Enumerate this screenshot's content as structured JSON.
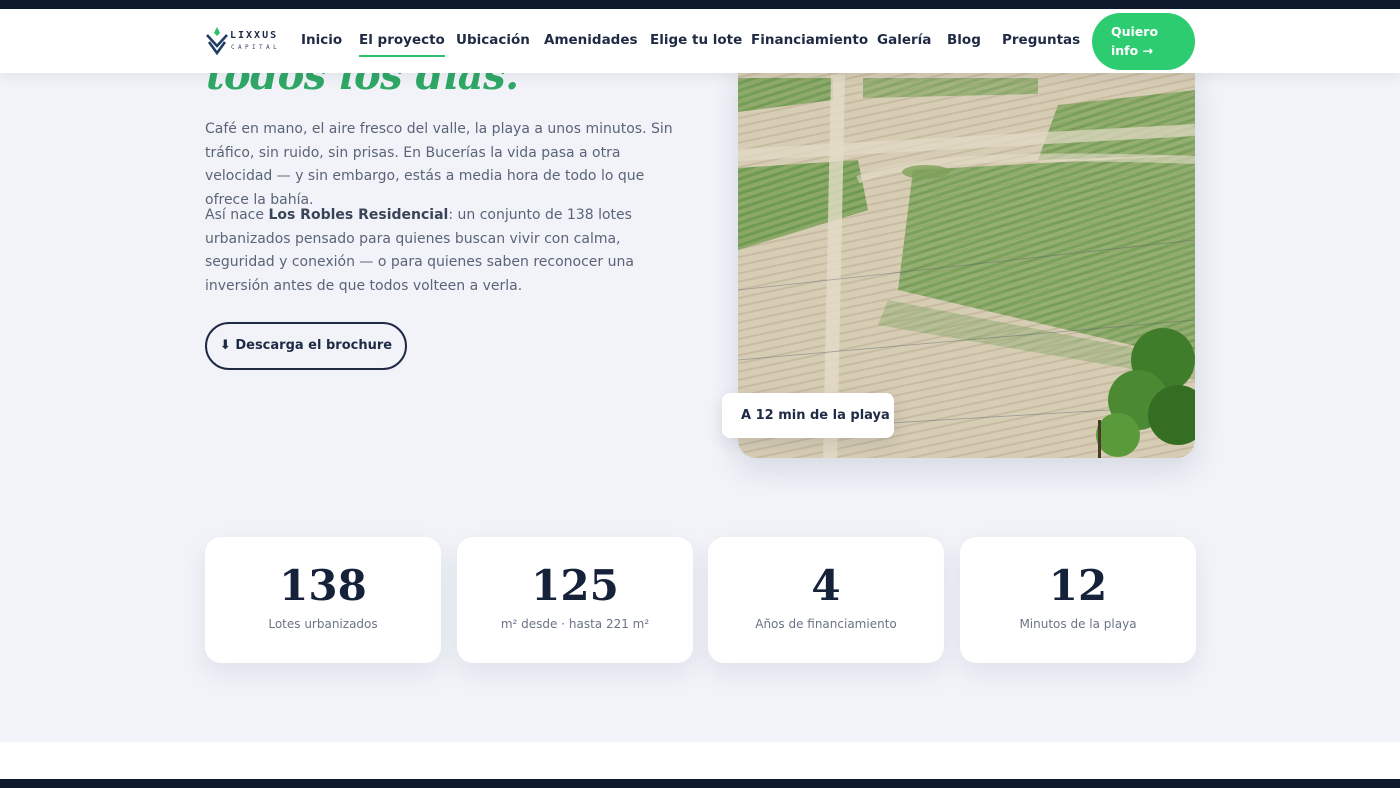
{
  "brand": {
    "name": "LIXXUS",
    "tagline": "CAPITAL"
  },
  "nav": {
    "items": [
      {
        "label": "Inicio"
      },
      {
        "label": "El proyecto"
      },
      {
        "label": "Ubicación"
      },
      {
        "label": "Amenidades"
      },
      {
        "label": "Elige tu lote"
      },
      {
        "label": "Financiamiento"
      },
      {
        "label": "Galería"
      },
      {
        "label": "Blog"
      },
      {
        "label": "Preguntas"
      }
    ],
    "active": "El proyecto",
    "cta_line1": "Quiero",
    "cta_line2": "info →"
  },
  "intro": {
    "headline": "todos los días.",
    "paragraph1": "Café en mano, el aire fresco del valle, la playa a unos minutos. Sin tráfico, sin ruido, sin prisas. En Bucerías la vida pasa a otra velocidad — y sin embargo, estás a media hora de todo lo que ofrece la bahía.",
    "paragraph2_prefix": "Así nace ",
    "paragraph2_bold": "Los Robles Residencial",
    "paragraph2_suffix": ": un conjunto de 138 lotes urbanizados pensado para quienes buscan vivir con calma, seguridad y conexión — o para quienes saben reconocer una inversión antes de que todos volteen a verla.",
    "brochure_label": "⬇ Descarga el brochure",
    "photo_badge": "A 12 min de la playa"
  },
  "stats": [
    {
      "value": "138",
      "label": "Lotes urbanizados"
    },
    {
      "value": "125",
      "label": "m² desde · hasta 221 m²"
    },
    {
      "value": "4",
      "label": "Años de financiamiento"
    },
    {
      "value": "12",
      "label": "Minutos de la playa"
    }
  ],
  "colors": {
    "accent": "#2ecc71",
    "navy": "#1f2a44",
    "background": "#f1f3f9"
  }
}
